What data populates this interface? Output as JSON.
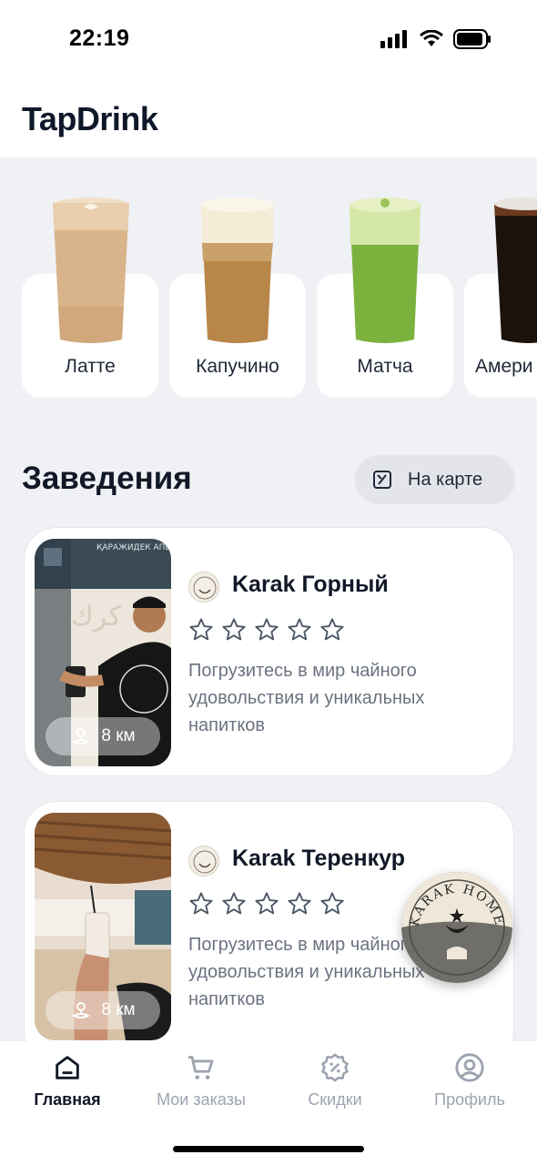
{
  "status_bar": {
    "time": "22:19"
  },
  "app": {
    "title": "TapDrink"
  },
  "drinks": [
    {
      "label": "Латте"
    },
    {
      "label": "Капучино"
    },
    {
      "label": "Матча"
    },
    {
      "label": "Амери"
    }
  ],
  "venues_section": {
    "title": "Заведения",
    "map_button": "На карте"
  },
  "venues": [
    {
      "name": "Karak Горный",
      "description": "Погрузитесь в мир чайного удовольствия и уникальных напитков",
      "distance": "8 км",
      "rating": 0,
      "photo_text": "ҚАРАЖИДЕК АПЕЛЬСИН"
    },
    {
      "name": "Karak Теренкур",
      "description": "Погрузитесь в мир чайного удовольствия и уникальных напитков",
      "distance": "8 км",
      "rating": 0
    }
  ],
  "floating_badge": {
    "text": "KARAK HOME"
  },
  "tabs": [
    {
      "label": "Главная",
      "icon": "home-icon",
      "active": true
    },
    {
      "label": "Мои заказы",
      "icon": "cart-icon",
      "active": false
    },
    {
      "label": "Скидки",
      "icon": "discount-icon",
      "active": false
    },
    {
      "label": "Профиль",
      "icon": "profile-icon",
      "active": false
    }
  ],
  "colors": {
    "accent": "#111827",
    "inactive": "#9ca3af",
    "background": "#f0f1f5"
  }
}
